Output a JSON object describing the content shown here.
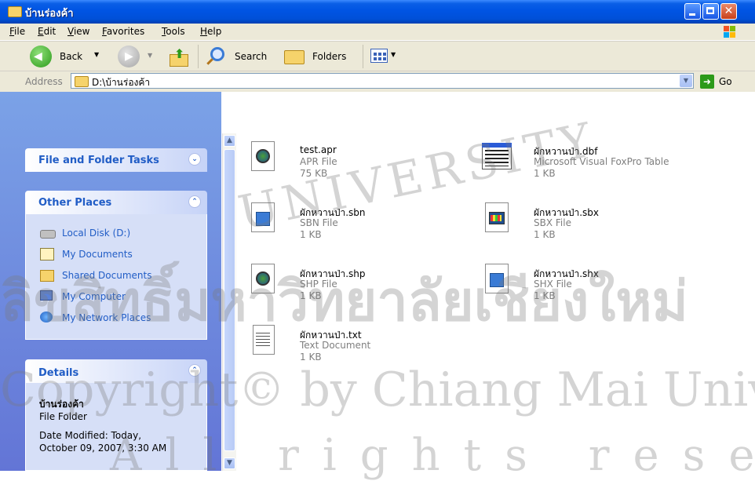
{
  "window": {
    "title": "บ้านร่องค้า"
  },
  "menu": {
    "items": [
      "File",
      "Edit",
      "View",
      "Favorites",
      "Tools",
      "Help"
    ]
  },
  "toolbar": {
    "back": "Back",
    "search": "Search",
    "folders": "Folders"
  },
  "address": {
    "label": "Address",
    "value": "D:\\บ้านร่องค้า",
    "go": "Go"
  },
  "left_panel": {
    "file_tasks": {
      "title": "File and Folder Tasks"
    },
    "other_places": {
      "title": "Other Places",
      "items": [
        "Local Disk (D:)",
        "My Documents",
        "Shared Documents",
        "My Computer",
        "My Network Places"
      ]
    },
    "details": {
      "title": "Details",
      "name": "บ้านร่องค้า",
      "type": "File Folder",
      "modified_line1": "Date Modified: Today,",
      "modified_line2": "October 09, 2007, 3:30 AM"
    }
  },
  "files": [
    {
      "name": "test.apr",
      "type": "APR File",
      "size": "75 KB",
      "icon": "apr-file-icon"
    },
    {
      "name": "ผักหวานป่า.dbf",
      "type": "Microsoft Visual FoxPro Table",
      "size": "1 KB",
      "icon": "dbf-table-icon"
    },
    {
      "name": "ผักหวานป่า.sbn",
      "type": "SBN File",
      "size": "1 KB",
      "icon": "sbn-file-icon"
    },
    {
      "name": "ผักหวานป่า.sbx",
      "type": "SBX File",
      "size": "1 KB",
      "icon": "sbx-file-icon"
    },
    {
      "name": "ผักหวานป่า.shp",
      "type": "SHP File",
      "size": "1 KB",
      "icon": "shp-file-icon"
    },
    {
      "name": "ผักหวานป่า.shx",
      "type": "SHX File",
      "size": "1 KB",
      "icon": "shx-file-icon"
    },
    {
      "name": "ผักหวานป่า.txt",
      "type": "Text Document",
      "size": "1 KB",
      "icon": "txt-file-icon"
    }
  ],
  "watermark": {
    "line1": "UNIVERSITY",
    "line2": "ลิขสิทธิ์มหาวิทยาลัยเชียงใหม่",
    "line3": "Copyright© by Chiang Mai University",
    "line4": "All rights reserved"
  }
}
